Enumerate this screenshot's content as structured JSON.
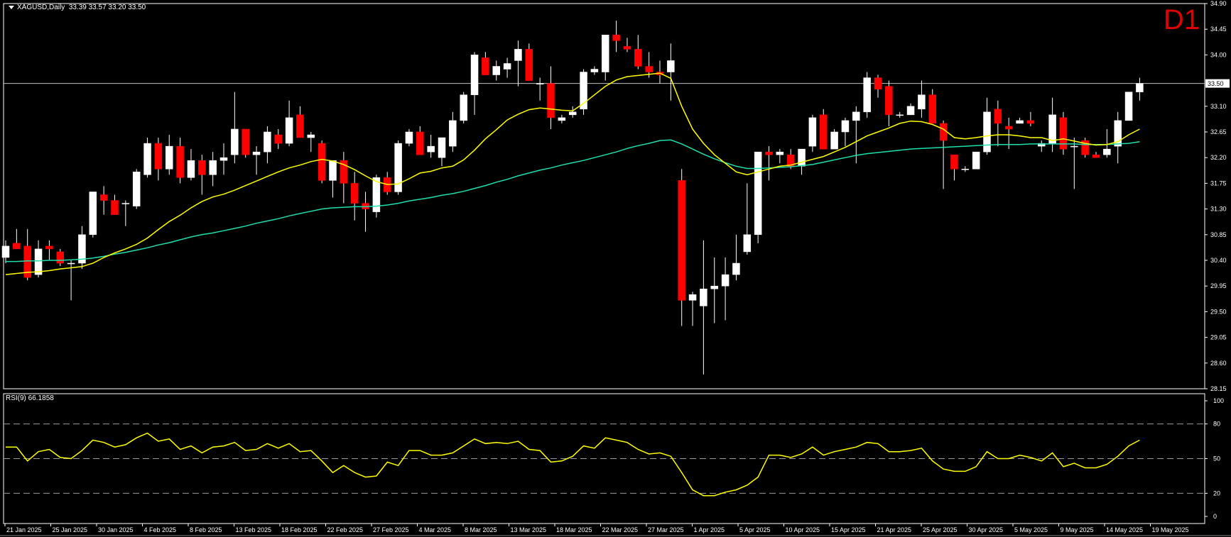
{
  "header": {
    "symbol_text": "XAGUSD,Daily",
    "ohlc_text": "33.39 33.57 33.20 33.50"
  },
  "timeframe_label": "D1",
  "rsi_header": "RSI(9) 66.1858",
  "current_price_label": "33.50",
  "colors": {
    "bull": "#ffffff",
    "bear": "#ff0000",
    "wick": "#ffffff",
    "ma_fast": "#ffff00",
    "ma_slow": "#1edfae",
    "rsi": "#ffff00",
    "bg": "#000000",
    "frame": "#ffffff",
    "tf": "#e00000"
  },
  "chart_data": [
    {
      "type": "candlestick",
      "x_tick_labels": [
        "21 Jan 2025",
        "25 Jan 2025",
        "30 Jan 2025",
        "4 Feb 2025",
        "8 Feb 2025",
        "13 Feb 2025",
        "18 Feb 2025",
        "22 Feb 2025",
        "27 Feb 2025",
        "4 Mar 2025",
        "8 Mar 2025",
        "13 Mar 2025",
        "18 Mar 2025",
        "22 Mar 2025",
        "27 Mar 2025",
        "1 Apr 2025",
        "5 Apr 2025",
        "10 Apr 2025",
        "15 Apr 2025",
        "21 Apr 2025",
        "25 Apr 2025",
        "30 Apr 2025",
        "5 May 2025",
        "9 May 2025",
        "14 May 2025",
        "19 May 2025"
      ],
      "y_tick_labels": [
        "34.90",
        "34.45",
        "34.00",
        "33.10",
        "32.65",
        "32.20",
        "31.75",
        "31.30",
        "30.85",
        "30.40",
        "29.95",
        "29.50",
        "29.05",
        "28.60",
        "28.15"
      ],
      "ylim": [
        28.15,
        34.9
      ],
      "current_price": 33.5,
      "ohlc": [
        [
          30.45,
          30.75,
          30.35,
          30.65
        ],
        [
          30.7,
          30.95,
          30.6,
          30.6
        ],
        [
          30.65,
          30.95,
          30.05,
          30.1
        ],
        [
          30.15,
          30.75,
          30.1,
          30.6
        ],
        [
          30.65,
          30.75,
          30.4,
          30.6
        ],
        [
          30.55,
          30.6,
          30.3,
          30.35
        ],
        [
          30.35,
          30.4,
          29.7,
          30.35
        ],
        [
          30.35,
          31.0,
          30.25,
          30.85
        ],
        [
          30.85,
          31.6,
          30.8,
          31.6
        ],
        [
          31.55,
          31.7,
          31.2,
          31.45
        ],
        [
          31.45,
          31.55,
          31.2,
          31.2
        ],
        [
          31.4,
          31.45,
          31.0,
          31.4
        ],
        [
          31.35,
          32.0,
          31.3,
          31.95
        ],
        [
          31.9,
          32.55,
          31.85,
          32.45
        ],
        [
          32.45,
          32.55,
          31.8,
          32.0
        ],
        [
          32.0,
          32.6,
          31.9,
          32.4
        ],
        [
          32.4,
          32.55,
          31.75,
          31.85
        ],
        [
          31.85,
          32.35,
          31.8,
          32.15
        ],
        [
          32.15,
          32.25,
          31.55,
          31.9
        ],
        [
          31.9,
          32.3,
          31.7,
          32.15
        ],
        [
          32.15,
          32.45,
          31.9,
          32.2
        ],
        [
          32.25,
          33.35,
          32.1,
          32.7
        ],
        [
          32.7,
          32.7,
          32.2,
          32.25
        ],
        [
          32.25,
          32.4,
          31.9,
          32.3
        ],
        [
          32.3,
          32.75,
          32.1,
          32.65
        ],
        [
          32.6,
          32.7,
          32.35,
          32.45
        ],
        [
          32.45,
          33.2,
          32.4,
          32.9
        ],
        [
          32.95,
          33.1,
          32.55,
          32.55
        ],
        [
          32.55,
          32.65,
          32.3,
          32.6
        ],
        [
          32.45,
          32.5,
          31.75,
          31.8
        ],
        [
          31.8,
          32.1,
          31.5,
          32.15
        ],
        [
          32.15,
          32.3,
          31.4,
          31.75
        ],
        [
          31.75,
          31.95,
          31.1,
          31.4
        ],
        [
          31.4,
          31.6,
          30.9,
          31.3
        ],
        [
          31.25,
          31.9,
          31.15,
          31.85
        ],
        [
          31.85,
          31.95,
          31.55,
          31.6
        ],
        [
          31.6,
          32.5,
          31.55,
          32.45
        ],
        [
          32.45,
          32.7,
          32.4,
          32.65
        ],
        [
          32.65,
          32.75,
          32.25,
          32.25
        ],
        [
          32.3,
          32.6,
          32.2,
          32.4
        ],
        [
          32.2,
          32.55,
          32.05,
          32.55
        ],
        [
          32.4,
          33.0,
          32.3,
          32.85
        ],
        [
          32.85,
          33.35,
          32.8,
          33.3
        ],
        [
          33.3,
          34.05,
          32.95,
          34.0
        ],
        [
          33.95,
          34.05,
          33.7,
          33.65
        ],
        [
          33.65,
          33.9,
          33.55,
          33.8
        ],
        [
          33.75,
          33.95,
          33.6,
          33.85
        ],
        [
          33.9,
          34.25,
          33.45,
          34.1
        ],
        [
          34.1,
          34.2,
          33.55,
          33.55
        ],
        [
          33.5,
          33.6,
          33.2,
          33.5
        ],
        [
          33.5,
          33.8,
          32.7,
          32.9
        ],
        [
          32.85,
          32.95,
          32.8,
          32.9
        ],
        [
          32.95,
          33.1,
          32.9,
          33.0
        ],
        [
          33.05,
          33.75,
          32.95,
          33.7
        ],
        [
          33.7,
          33.8,
          33.65,
          33.75
        ],
        [
          33.7,
          34.35,
          33.55,
          34.35
        ],
        [
          34.35,
          34.6,
          34.05,
          34.25
        ],
        [
          34.15,
          34.3,
          34.05,
          34.1
        ],
        [
          34.1,
          34.35,
          33.75,
          33.8
        ],
        [
          33.8,
          34.05,
          33.6,
          33.7
        ],
        [
          33.7,
          33.9,
          33.5,
          33.65
        ],
        [
          33.7,
          34.2,
          33.2,
          33.9
        ],
        [
          31.8,
          32.0,
          29.25,
          29.7
        ],
        [
          29.7,
          29.85,
          29.25,
          29.8
        ],
        [
          29.6,
          30.75,
          28.4,
          29.9
        ],
        [
          29.9,
          30.45,
          29.3,
          29.95
        ],
        [
          29.95,
          30.45,
          29.35,
          30.15
        ],
        [
          30.15,
          30.85,
          30.05,
          30.35
        ],
        [
          30.55,
          31.75,
          30.5,
          30.85
        ],
        [
          30.85,
          32.25,
          30.7,
          32.3
        ],
        [
          32.3,
          32.4,
          31.8,
          32.25
        ],
        [
          32.25,
          32.35,
          32.1,
          32.3
        ],
        [
          32.25,
          32.35,
          32.0,
          32.05
        ],
        [
          32.05,
          32.35,
          31.9,
          32.35
        ],
        [
          32.4,
          32.95,
          32.3,
          32.9
        ],
        [
          32.95,
          33.05,
          32.35,
          32.35
        ],
        [
          32.35,
          32.7,
          32.35,
          32.65
        ],
        [
          32.65,
          32.9,
          32.4,
          32.85
        ],
        [
          32.85,
          33.1,
          32.1,
          33.0
        ],
        [
          33.0,
          33.7,
          32.9,
          33.6
        ],
        [
          33.6,
          33.65,
          33.25,
          33.4
        ],
        [
          33.45,
          33.55,
          32.75,
          32.95
        ],
        [
          32.95,
          33.0,
          32.9,
          32.95
        ],
        [
          32.95,
          33.15,
          32.95,
          33.1
        ],
        [
          33.05,
          33.55,
          32.9,
          33.3
        ],
        [
          33.3,
          33.4,
          32.9,
          32.8
        ],
        [
          32.8,
          32.85,
          31.65,
          32.5
        ],
        [
          32.25,
          32.25,
          31.8,
          32.0
        ],
        [
          32.0,
          32.05,
          31.95,
          32.0
        ],
        [
          32.0,
          32.3,
          32.0,
          32.3
        ],
        [
          32.3,
          33.25,
          32.25,
          33.0
        ],
        [
          33.05,
          33.2,
          32.4,
          32.8
        ],
        [
          32.75,
          32.9,
          32.35,
          32.7
        ],
        [
          32.8,
          32.9,
          32.8,
          32.85
        ],
        [
          32.85,
          33.0,
          32.75,
          32.8
        ],
        [
          32.4,
          32.5,
          32.3,
          32.45
        ],
        [
          32.45,
          33.25,
          32.3,
          32.95
        ],
        [
          32.9,
          33.0,
          32.25,
          32.35
        ],
        [
          32.4,
          32.55,
          31.65,
          32.4
        ],
        [
          32.5,
          32.55,
          32.2,
          32.25
        ],
        [
          32.25,
          32.3,
          32.2,
          32.2
        ],
        [
          32.25,
          32.7,
          32.2,
          32.35
        ],
        [
          32.4,
          33.0,
          32.1,
          32.85
        ],
        [
          32.85,
          33.25,
          32.85,
          33.35
        ],
        [
          33.35,
          33.6,
          33.2,
          33.5
        ]
      ],
      "ma_fast": [
        30.15,
        30.17,
        30.19,
        30.2,
        30.22,
        30.25,
        30.27,
        30.29,
        30.35,
        30.45,
        30.53,
        30.6,
        30.68,
        30.79,
        30.94,
        31.08,
        31.19,
        31.32,
        31.43,
        31.51,
        31.56,
        31.63,
        31.71,
        31.79,
        31.87,
        31.95,
        32.02,
        32.07,
        32.13,
        32.17,
        32.14,
        32.08,
        31.99,
        31.88,
        31.78,
        31.73,
        31.74,
        31.83,
        31.93,
        31.96,
        32.02,
        32.05,
        32.16,
        32.33,
        32.53,
        32.69,
        32.86,
        32.96,
        33.04,
        33.07,
        33.05,
        33.03,
        33.02,
        33.15,
        33.3,
        33.45,
        33.56,
        33.62,
        33.64,
        33.66,
        33.68,
        33.59,
        33.1,
        32.7,
        32.45,
        32.25,
        32.1,
        31.95,
        31.9,
        31.95,
        32.0,
        32.05,
        32.07,
        32.12,
        32.17,
        32.22,
        32.3,
        32.38,
        32.48,
        32.58,
        32.65,
        32.72,
        32.8,
        32.84,
        32.83,
        32.78,
        32.7,
        32.55,
        32.53,
        32.55,
        32.58,
        32.6,
        32.6,
        32.58,
        32.55,
        32.55,
        32.5,
        32.53,
        32.49,
        32.45,
        32.42,
        32.43,
        32.48,
        32.6,
        32.7
      ],
      "ma_slow": [
        30.38,
        30.38,
        30.39,
        30.39,
        30.4,
        30.4,
        30.41,
        30.42,
        30.44,
        30.47,
        30.51,
        30.54,
        30.58,
        30.62,
        30.67,
        30.71,
        30.76,
        30.81,
        30.85,
        30.88,
        30.92,
        30.96,
        31.0,
        31.05,
        31.09,
        31.13,
        31.18,
        31.22,
        31.26,
        31.3,
        31.32,
        31.33,
        31.34,
        31.34,
        31.35,
        31.37,
        31.4,
        31.44,
        31.47,
        31.5,
        31.54,
        31.57,
        31.61,
        31.66,
        31.71,
        31.77,
        31.82,
        31.88,
        31.93,
        31.98,
        32.02,
        32.07,
        32.11,
        32.15,
        32.2,
        32.25,
        32.3,
        32.36,
        32.41,
        32.45,
        32.5,
        32.51,
        32.44,
        32.35,
        32.26,
        32.18,
        32.11,
        32.05,
        32.01,
        32.01,
        32.02,
        32.03,
        32.04,
        32.06,
        32.08,
        32.12,
        32.16,
        32.2,
        32.24,
        32.27,
        32.29,
        32.31,
        32.33,
        32.35,
        32.36,
        32.37,
        32.38,
        32.39,
        32.4,
        32.41,
        32.42,
        32.43,
        32.43,
        32.43,
        32.44,
        32.44,
        32.44,
        32.44,
        32.44,
        32.43,
        32.43,
        32.43,
        32.44,
        32.45,
        32.48
      ]
    },
    {
      "type": "line",
      "title": "RSI(9) 66.1858",
      "ylim": [
        0,
        100
      ],
      "y_tick_labels": [
        "100",
        "80",
        "50",
        "20",
        "0"
      ],
      "levels": [
        80,
        50,
        20
      ],
      "values": [
        60,
        60,
        48,
        56,
        58,
        51,
        50,
        57,
        66,
        64,
        60,
        62,
        68,
        72,
        65,
        67,
        58,
        61,
        55,
        60,
        61,
        64,
        57,
        58,
        63,
        59,
        63,
        56,
        57,
        48,
        38,
        44,
        38,
        34,
        35,
        47,
        44,
        57,
        57,
        53,
        53,
        55,
        61,
        67,
        63,
        64,
        63,
        65,
        58,
        57,
        47,
        48,
        52,
        61,
        59,
        68,
        66,
        64,
        58,
        54,
        55,
        52,
        38,
        23,
        18,
        18,
        21,
        23,
        27,
        34,
        53,
        53,
        51,
        54,
        60,
        53,
        56,
        58,
        60,
        64,
        63,
        56,
        56,
        57,
        59,
        48,
        41,
        39,
        39,
        43,
        56,
        50,
        50,
        53,
        51,
        48,
        55,
        43,
        46,
        42,
        42,
        45,
        52,
        61,
        66
      ]
    }
  ]
}
